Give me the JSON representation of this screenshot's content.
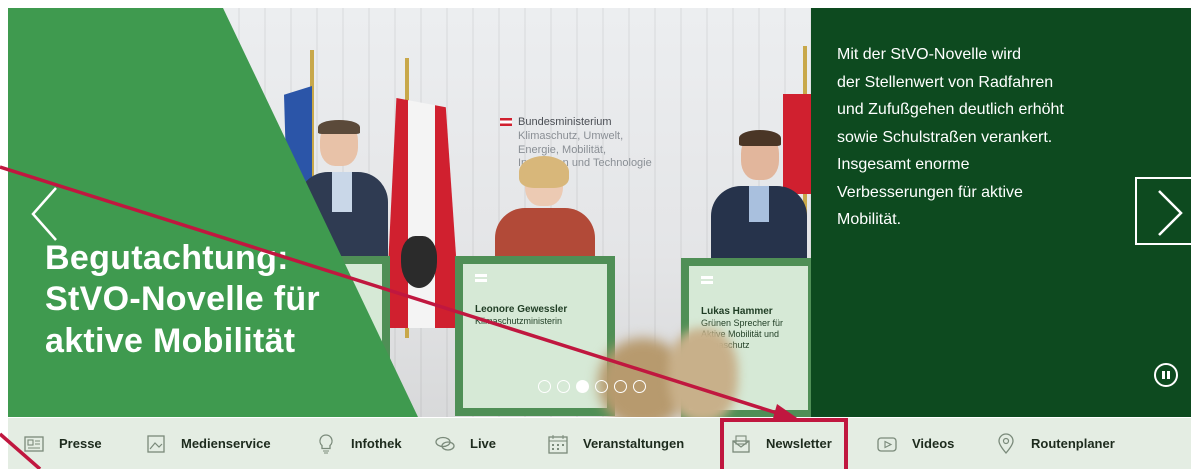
{
  "hero": {
    "headline_lines": [
      "Begutachtung:",
      "StVO-Novelle für",
      "aktive Mobilität"
    ],
    "description": "Mit der StVO-Novelle wird der Stellenwert von Radfahren und Zufußgehen deutlich erhöht sowie Schulstraßen verankert. Insgesamt enorme Verbesserungen für aktive Mobilität.",
    "description_lines": [
      "Mit der StVO-Novelle wird",
      "der Stellenwert von Radfahren",
      "und Zufußgehen deutlich erhöht",
      "sowie Schulstraßen verankert.",
      "Insgesamt enorme",
      "Verbesserungen für aktive",
      "Mobilität."
    ],
    "slide_count": 6,
    "active_slide_index": 2,
    "photo": {
      "ministry_lines": [
        "Bundesministerium",
        "Klimaschutz, Umwelt,",
        "Energie, Mobilität,",
        "Innovation und Technologie"
      ],
      "podium_center": {
        "name": "Leonore Gewessler",
        "role": "Klimaschutzministerin"
      },
      "podium_right": {
        "name": "Lukas Hammer",
        "role_lines": [
          "Grünen Sprecher für",
          "Aktive Mobilität und Klimaschutz"
        ]
      }
    }
  },
  "nav": {
    "items": [
      {
        "label": "Presse",
        "icon": "newspaper-icon"
      },
      {
        "label": "Medienservice",
        "icon": "image-icon"
      },
      {
        "label": "Infothek",
        "icon": "lightbulb-icon"
      },
      {
        "label": "Live",
        "icon": "chat-bubbles-icon"
      },
      {
        "label": "Veranstaltungen",
        "icon": "calendar-icon"
      },
      {
        "label": "Newsletter",
        "icon": "envelope-icon"
      },
      {
        "label": "Videos",
        "icon": "play-icon"
      },
      {
        "label": "Routenplaner",
        "icon": "map-pin-icon"
      }
    ],
    "highlighted": "Newsletter"
  },
  "colors": {
    "hero_green": "#3f9a4f",
    "panel_green": "#0d4a1f",
    "nav_bg": "#e4ede3",
    "annotation": "#c0173f"
  }
}
